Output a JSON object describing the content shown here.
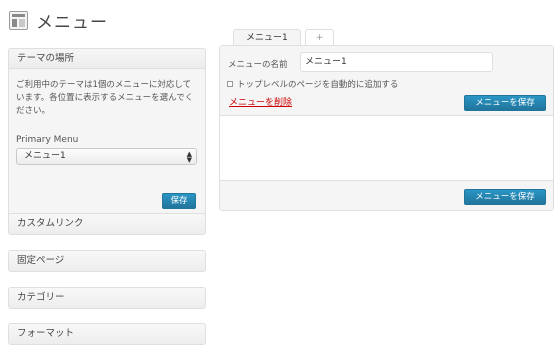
{
  "header": {
    "title": "メニュー",
    "icon": "menu-editor-icon"
  },
  "locations": {
    "title": "テーマの場所",
    "description": "ご利用中のテーマは1個のメニューに対応しています。各位置に表示するメニューを選んでください。",
    "primary_label": "Primary Menu",
    "primary_value": "メニュー1",
    "save_label": "保存"
  },
  "meta_boxes": [
    {
      "label": "カスタムリンク"
    },
    {
      "label": "固定ページ"
    },
    {
      "label": "カテゴリー"
    },
    {
      "label": "フォーマット"
    }
  ],
  "tabs": [
    {
      "label": "メニュー1",
      "active": true
    },
    {
      "label": "+",
      "active": false
    }
  ],
  "editor": {
    "name_label": "メニューの名前",
    "name_value": "メニュー1",
    "auto_add_label": "トップレベルのページを自動的に追加する",
    "delete_label": "メニューを削除",
    "save_label": "メニューを保存",
    "save_bottom_label": "メニューを保存"
  },
  "colors": {
    "primary_button": "#21759b",
    "delete_link": "#cc0000",
    "panel_bg": "#f5f5f5",
    "border": "#dfdfdf"
  }
}
